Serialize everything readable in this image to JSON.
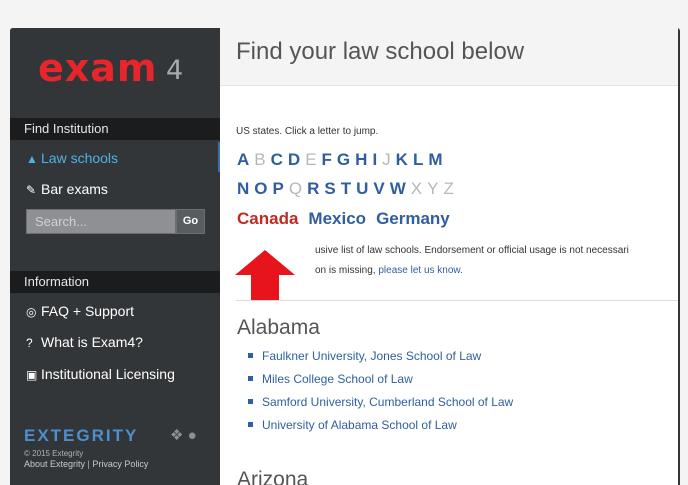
{
  "sidebar": {
    "logo": {
      "text": "exam",
      "suffix": "4"
    },
    "find_heading": "Find Institution",
    "items": [
      {
        "label": "Law schools",
        "icon": "graduation-cap-icon"
      },
      {
        "label": "Bar exams",
        "icon": "edit-icon"
      }
    ],
    "search": {
      "placeholder": "Search...",
      "button": "Go"
    },
    "info_heading": "Information",
    "info_items": [
      {
        "label": "FAQ + Support",
        "icon": "lifebuoy-icon"
      },
      {
        "label": "What is Exam4?",
        "icon": "question-icon"
      },
      {
        "label": "Institutional Licensing",
        "icon": "license-icon"
      }
    ],
    "footer": {
      "brand": "EXTEGRITY",
      "copyright": "© 2015 Extegrity",
      "about": "About Extegrity",
      "separator": "|",
      "privacy": "Privacy Policy"
    }
  },
  "main": {
    "title": "Find your law school below",
    "intro": "US states. Click a letter to jump.",
    "letters_row1": [
      {
        "l": "A",
        "on": true
      },
      {
        "l": "B",
        "on": false
      },
      {
        "l": "C",
        "on": true
      },
      {
        "l": "D",
        "on": true
      },
      {
        "l": "E",
        "on": false
      },
      {
        "l": "F",
        "on": true
      },
      {
        "l": "G",
        "on": true
      },
      {
        "l": "H",
        "on": true
      },
      {
        "l": "I",
        "on": true
      },
      {
        "l": "J",
        "on": false
      },
      {
        "l": "K",
        "on": true
      },
      {
        "l": "L",
        "on": true
      },
      {
        "l": "M",
        "on": true
      }
    ],
    "letters_row2": [
      {
        "l": "N",
        "on": true
      },
      {
        "l": "O",
        "on": true
      },
      {
        "l": "P",
        "on": true
      },
      {
        "l": "Q",
        "on": false
      },
      {
        "l": "R",
        "on": true
      },
      {
        "l": "S",
        "on": true
      },
      {
        "l": "T",
        "on": true
      },
      {
        "l": "U",
        "on": true
      },
      {
        "l": "V",
        "on": true
      },
      {
        "l": "W",
        "on": true
      },
      {
        "l": "X",
        "on": false
      },
      {
        "l": "Y",
        "on": false
      },
      {
        "l": "Z",
        "on": false
      }
    ],
    "countries": {
      "canada": "Canada",
      "mexico": "Mexico",
      "germany": "Germany"
    },
    "disclaimer_line1": "usive list of law schools. Endorsement or official usage is not necessari",
    "disclaimer_line2_prefix": "on is missing, ",
    "disclaimer_link": "please let us know.",
    "states": [
      {
        "name": "Alabama",
        "schools": [
          "Faulkner University, Jones School of Law",
          "Miles College School of Law",
          "Samford University, Cumberland School of Law",
          "University of Alabama School of Law"
        ]
      },
      {
        "name": "Arizona",
        "schools": []
      }
    ]
  },
  "colors": {
    "accent_red": "#e8252b",
    "link_blue": "#2f5fa0",
    "active_nav": "#4db3e6",
    "sidebar_bg": "#333639"
  }
}
